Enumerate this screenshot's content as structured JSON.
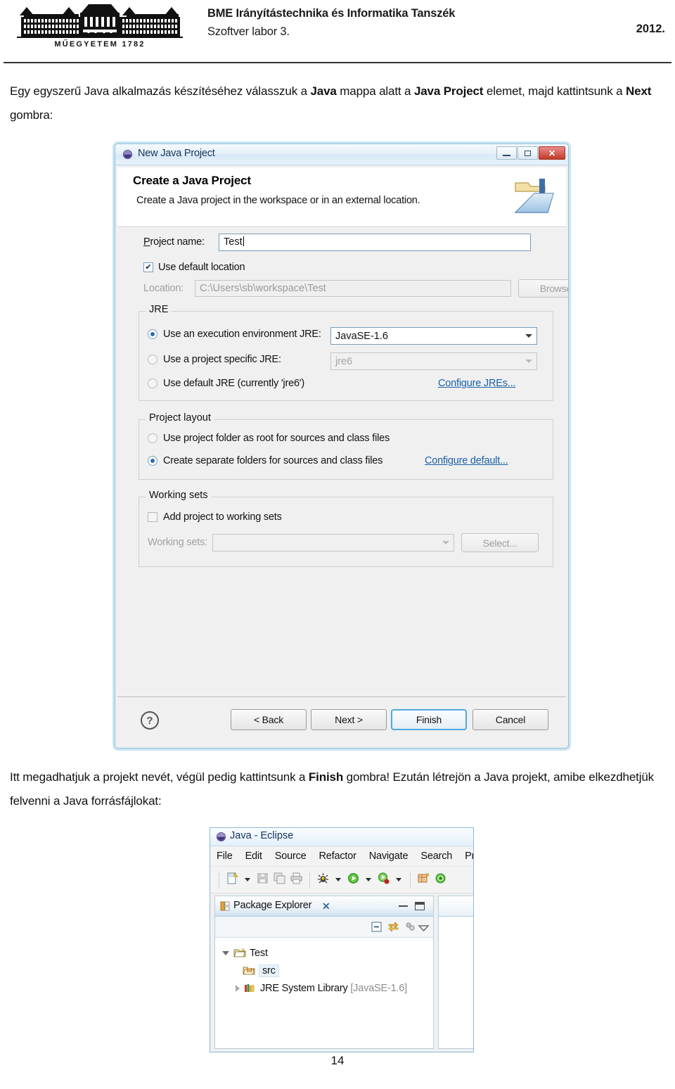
{
  "header": {
    "logo_caption": "M Ű E G Y E T E M  1 7 8 2",
    "line1": "BME Irányítástechnika és Informatika Tanszék",
    "line2": "Szoftver labor 3.",
    "year": "2012."
  },
  "intro_paragraph": {
    "part1": "Egy egyszerű Java alkalmazás készítéséhez válasszuk a ",
    "bold1": "Java",
    "part2": " mappa alatt a ",
    "bold2": "Java Project",
    "part3": " elemet, majd kattintsunk a ",
    "bold3": "Next",
    "part4": " gombra:"
  },
  "mid_paragraph": {
    "part1": "Itt megadhatjuk a projekt nevét, végül pedig kattintsunk a ",
    "bold1": "Finish",
    "part2": " gombra! Ezután létrejön a Java projekt, amibe elkezdhetjük felvenni a Java forrásfájlokat:"
  },
  "page_number": "14",
  "dialog": {
    "title": "New Java Project",
    "window_buttons": {
      "minimize": "minimize-icon",
      "maximize": "maximize-icon",
      "close": "✕"
    },
    "banner": {
      "title": "Create a Java Project",
      "subtitle": "Create a Java project in the workspace or in an external location.",
      "icon": "new-java-project-folder-icon"
    },
    "project_name": {
      "label": "Project name:",
      "value": "Test"
    },
    "use_default_location": {
      "label": "Use default location",
      "checked": true,
      "mark": "✔"
    },
    "location": {
      "label": "Location:",
      "value": "C:\\Users\\sb\\workspace\\Test",
      "browse_label": "Browse..."
    },
    "jre": {
      "group_label": "JRE",
      "option_exec_env": {
        "label": "Use an execution environment JRE:",
        "selected": true,
        "value": "JavaSE-1.6"
      },
      "option_project_specific": {
        "label": "Use a project specific JRE:",
        "selected": false,
        "value": "jre6"
      },
      "option_default": {
        "label": "Use default JRE (currently 'jre6')",
        "selected": false
      },
      "configure_link": "Configure JREs..."
    },
    "project_layout": {
      "group_label": "Project layout",
      "option_root": {
        "label": "Use project folder as root for sources and class files",
        "selected": false
      },
      "option_separate": {
        "label": "Create separate folders for sources and class files",
        "selected": true
      },
      "configure_link": "Configure default..."
    },
    "working_sets": {
      "group_label": "Working sets",
      "add_checkbox": {
        "label": "Add project to working sets",
        "checked": false
      },
      "select_label": "Working sets:",
      "select_value": "",
      "select_button": "Select..."
    },
    "footer": {
      "help": "?",
      "back": "< Back",
      "next": "Next >",
      "finish": "Finish",
      "cancel": "Cancel"
    }
  },
  "eclipse": {
    "title": "Java - Eclipse",
    "menus": [
      "File",
      "Edit",
      "Source",
      "Refactor",
      "Navigate",
      "Search",
      "Pr"
    ],
    "toolbar_icons": [
      "new-file-icon",
      "dropdown-arrow-icon",
      "save-icon",
      "save-all-icon",
      "print-icon",
      "debug-icon",
      "dropdown-arrow-icon",
      "run-icon",
      "dropdown-arrow-icon",
      "run-external-icon",
      "dropdown-arrow-icon",
      "new-java-package-icon",
      "open-type-icon"
    ],
    "view": {
      "tab_label": "Package Explorer",
      "tab_icon": "package-explorer-icon",
      "tab_close": "✕",
      "toolbar_icons": [
        "collapse-all-icon",
        "link-with-editor-icon",
        "view-menu-icon",
        "view-dropdown-icon"
      ]
    },
    "tree": [
      {
        "label": "Test",
        "icon": "java-project-icon",
        "expanded": true,
        "indent": 0,
        "selected": false
      },
      {
        "label": "src",
        "icon": "source-folder-icon",
        "indent": 1,
        "selected": true
      },
      {
        "label": "JRE System Library",
        "suffix": " [JavaSE-1.6]",
        "icon": "jre-library-icon",
        "expanded": false,
        "indent": 1,
        "selected": false
      }
    ]
  },
  "colors": {
    "dialog_border": "#8fc3e0",
    "dialog_bg": "#f0f0f0",
    "link": "#1b5fa8",
    "close_button": "#c23b29",
    "finish_focus": "#4fa8df",
    "title_text": "#16325c"
  }
}
